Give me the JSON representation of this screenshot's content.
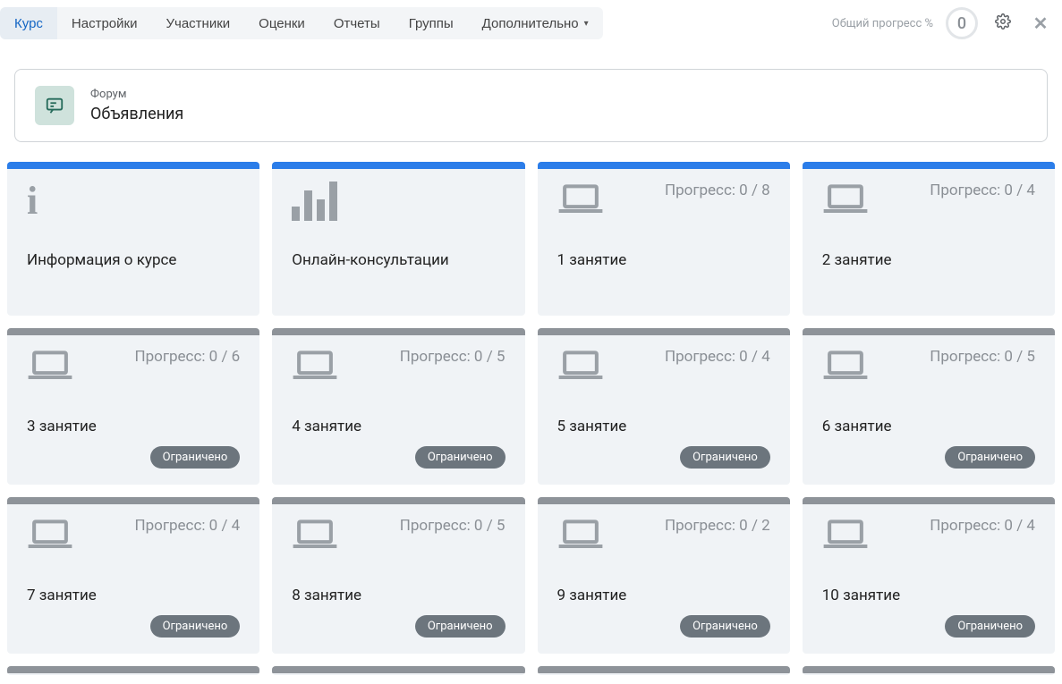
{
  "nav": {
    "tabs": [
      {
        "label": "Курс",
        "active": true
      },
      {
        "label": "Настройки"
      },
      {
        "label": "Участники"
      },
      {
        "label": "Оценки"
      },
      {
        "label": "Отчеты"
      },
      {
        "label": "Группы"
      },
      {
        "label": "Дополнительно",
        "dropdown": true
      }
    ]
  },
  "header": {
    "progress_label": "Общий прогресс %",
    "progress_value": "0"
  },
  "forum": {
    "type": "Форум",
    "title": "Объявления"
  },
  "progress_word": "Прогресс:",
  "restricted_label": "Ограничено",
  "cards": [
    {
      "icon": "info",
      "stripe": "blue",
      "title": "Информация о курсе"
    },
    {
      "icon": "bars",
      "stripe": "blue",
      "title": "Онлайн-консультации"
    },
    {
      "icon": "laptop",
      "stripe": "blue",
      "title": "1 занятие",
      "progress": "0 / 8"
    },
    {
      "icon": "laptop",
      "stripe": "blue",
      "title": "2 занятие",
      "progress": "0 / 4"
    },
    {
      "icon": "laptop",
      "stripe": "gray",
      "title": "3 занятие",
      "progress": "0 / 6",
      "restricted": true
    },
    {
      "icon": "laptop",
      "stripe": "gray",
      "title": "4 занятие",
      "progress": "0 / 5",
      "restricted": true
    },
    {
      "icon": "laptop",
      "stripe": "gray",
      "title": "5 занятие",
      "progress": "0 / 4",
      "restricted": true
    },
    {
      "icon": "laptop",
      "stripe": "gray",
      "title": "6 занятие",
      "progress": "0 / 5",
      "restricted": true
    },
    {
      "icon": "laptop",
      "stripe": "gray",
      "title": "7 занятие",
      "progress": "0 / 4",
      "restricted": true
    },
    {
      "icon": "laptop",
      "stripe": "gray",
      "title": "8 занятие",
      "progress": "0 / 5",
      "restricted": true
    },
    {
      "icon": "laptop",
      "stripe": "gray",
      "title": "9 занятие",
      "progress": "0 / 2",
      "restricted": true
    },
    {
      "icon": "laptop",
      "stripe": "gray",
      "title": "10 занятие",
      "progress": "0 / 4",
      "restricted": true
    }
  ],
  "partial_cards": [
    {
      "stripe": "gray"
    },
    {
      "stripe": "gray"
    },
    {
      "stripe": "gray"
    },
    {
      "stripe": "gray"
    }
  ]
}
